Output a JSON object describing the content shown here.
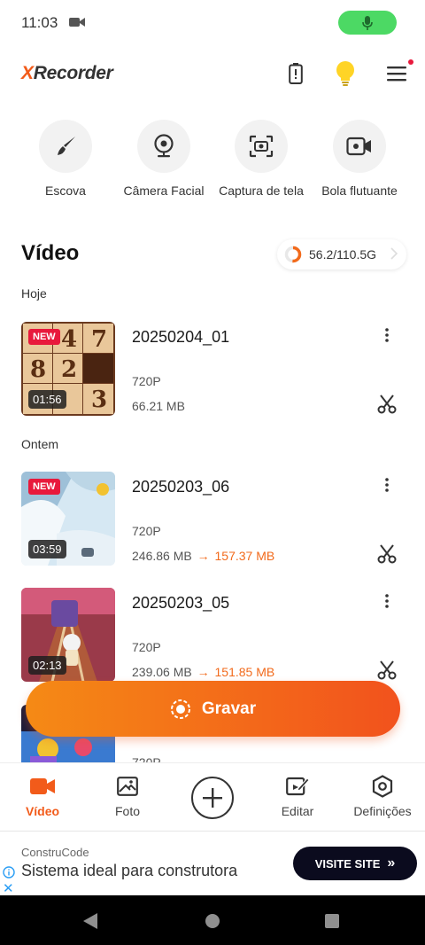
{
  "status_bar": {
    "time": "11:03"
  },
  "header": {
    "logo_prefix": "X",
    "logo_rest": "Recorder"
  },
  "tools": [
    {
      "label": "Escova",
      "icon": "brush-icon"
    },
    {
      "label": "Câmera Facial",
      "icon": "webcam-icon"
    },
    {
      "label": "Captura de tela",
      "icon": "screenshot-icon"
    },
    {
      "label": "Bola flutuante",
      "icon": "floating-camera-icon"
    }
  ],
  "section": {
    "title": "Vídeo",
    "storage": "56.2/110.5G",
    "storage_used_fraction": 0.51
  },
  "groups": {
    "today": "Hoje",
    "yesterday": "Ontem"
  },
  "videos": [
    {
      "title": "20250204_01",
      "badge": "NEW",
      "duration": "01:56",
      "resolution": "720P",
      "size": "66.21 MB",
      "arrow": "",
      "new_size": ""
    },
    {
      "title": "20250203_06",
      "badge": "NEW",
      "duration": "03:59",
      "resolution": "720P",
      "size": "246.86 MB",
      "arrow": "→",
      "new_size": "157.37 MB"
    },
    {
      "title": "20250203_05",
      "badge": "",
      "duration": "02:13",
      "resolution": "720P",
      "size": "239.06 MB",
      "arrow": "→",
      "new_size": "151.85 MB"
    },
    {
      "resolution": "720P"
    }
  ],
  "record_button": {
    "label": "Gravar"
  },
  "bottom_nav": [
    {
      "label": "Vídeo",
      "icon": "video-camera-icon",
      "active": true
    },
    {
      "label": "Foto",
      "icon": "photo-icon",
      "active": false
    },
    {
      "label": "",
      "icon": "add-icon",
      "active": false
    },
    {
      "label": "Editar",
      "icon": "edit-icon",
      "active": false
    },
    {
      "label": "Definições",
      "icon": "settings-icon",
      "active": false
    }
  ],
  "ad": {
    "brand": "ConstruCode",
    "text": "Sistema ideal para construtora",
    "cta": "VISITE SITE",
    "cta_chevron": "»",
    "close": "✕"
  },
  "colors": {
    "accent": "#f25b1a",
    "gradient_start": "#f58a15",
    "gradient_end": "#f2521d",
    "mic_pill": "#4cd964",
    "badge": "#e8193c"
  }
}
